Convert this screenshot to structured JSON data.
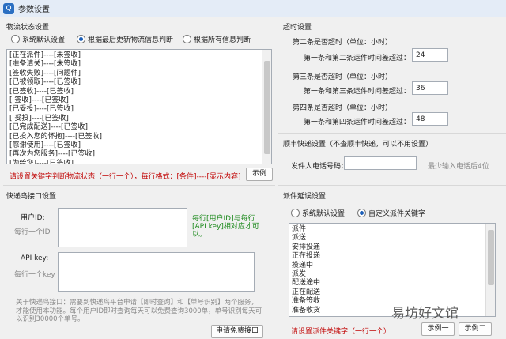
{
  "window": {
    "title": "参数设置"
  },
  "logistics": {
    "title": "物流状态设置",
    "radios": [
      {
        "label": "系统默认设置",
        "checked": false
      },
      {
        "label": "根据最后更新物流信息判断",
        "checked": true
      },
      {
        "label": "根据所有信息判断",
        "checked": false
      }
    ],
    "lines": [
      "[正在派件]----[未签收]",
      "[准备清关]----[未签收]",
      "[签收失败]----[问题件]",
      "[已被领取]----[已签收]",
      "[已签收]----[已签收]",
      "[ 签收]----[已签收]",
      "[已妥投]----[已签收]",
      "[ 妥投]----[已签收]",
      "[已完成配送]----[已签收]",
      "[已投入您的怀抱]----[已签收]",
      "[感谢使用]----[已签收]",
      "[再次为您服务]----[已签收]",
      "[为给您]----[已签收]"
    ],
    "hint": "请设置关键字判断物流状态（一行一个），每行格式：[条件]----[显示内容]",
    "example_button": "示例"
  },
  "timeout": {
    "title": "超时设置",
    "groups": [
      {
        "heading": "第二条是否超时（单位：小时）",
        "label": "第一条和第二条运件时间差超过：",
        "value": "24"
      },
      {
        "heading": "第三条是否超时（单位：小时）",
        "label": "第一条和第三条运件时间差超过：",
        "value": "36"
      },
      {
        "heading": "第四条是否超时（单位：小时）",
        "label": "第一条和第四条运件时间差超过：",
        "value": "48"
      }
    ]
  },
  "sf": {
    "title": "顺丰快递设置（不查顺丰快递，可以不用设置）",
    "label": "发件人电话号码：",
    "hint": "最少输入电话后4位"
  },
  "kdn": {
    "title": "快递鸟接口设置",
    "userid_label": "用户ID:",
    "userid_placeholder": "每行一个ID",
    "userid_note": "每行[用户ID]与每行[API key]相对应才可以。",
    "apikey_label": "API key:",
    "apikey_placeholder": "每行一个key",
    "about": "关于快递鸟接口：需要到快递鸟平台申请【即时查询】和【单号识别】两个服务，才能使用本功能。每个用户ID即时查询每天可以免费查询3000单，单号识别每天可以识别30000个单号。",
    "apply_button": "申请免费接口"
  },
  "dispatch": {
    "title": "派件延误设置",
    "radios": [
      {
        "label": "系统默认设置",
        "checked": false
      },
      {
        "label": "自定义派件关键字",
        "checked": true
      }
    ],
    "lines": [
      "派件",
      "派送",
      "安排投递",
      "正在投递",
      "投递中",
      "派发",
      "配送途中",
      "正在配送",
      "准备签收",
      "准备收货"
    ],
    "hint": "请设置派件关键字（一行一个）",
    "example1_button": "示例一",
    "example2_button": "示例二"
  },
  "watermark": "易坊好文馆"
}
